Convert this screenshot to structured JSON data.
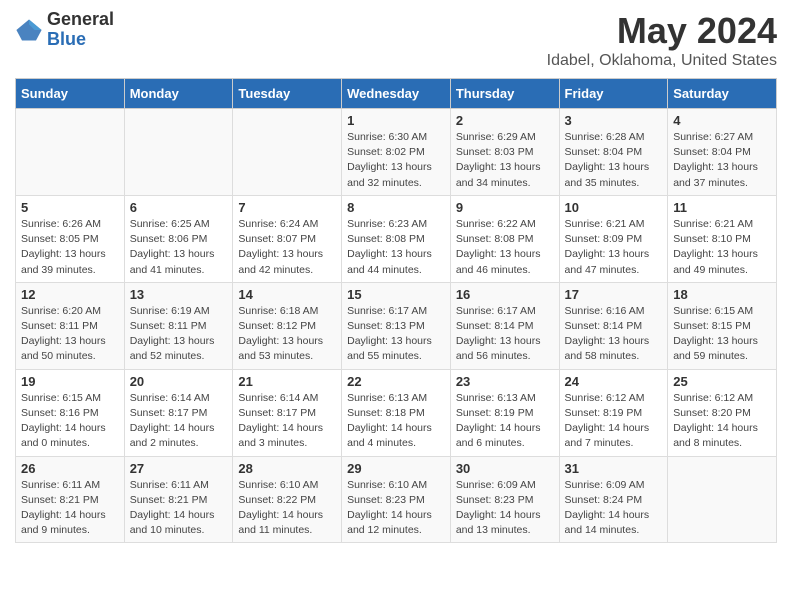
{
  "logo": {
    "general": "General",
    "blue": "Blue"
  },
  "title": "May 2024",
  "subtitle": "Idabel, Oklahoma, United States",
  "days_of_week": [
    "Sunday",
    "Monday",
    "Tuesday",
    "Wednesday",
    "Thursday",
    "Friday",
    "Saturday"
  ],
  "weeks": [
    [
      {
        "num": "",
        "info": ""
      },
      {
        "num": "",
        "info": ""
      },
      {
        "num": "",
        "info": ""
      },
      {
        "num": "1",
        "info": "Sunrise: 6:30 AM\nSunset: 8:02 PM\nDaylight: 13 hours\nand 32 minutes."
      },
      {
        "num": "2",
        "info": "Sunrise: 6:29 AM\nSunset: 8:03 PM\nDaylight: 13 hours\nand 34 minutes."
      },
      {
        "num": "3",
        "info": "Sunrise: 6:28 AM\nSunset: 8:04 PM\nDaylight: 13 hours\nand 35 minutes."
      },
      {
        "num": "4",
        "info": "Sunrise: 6:27 AM\nSunset: 8:04 PM\nDaylight: 13 hours\nand 37 minutes."
      }
    ],
    [
      {
        "num": "5",
        "info": "Sunrise: 6:26 AM\nSunset: 8:05 PM\nDaylight: 13 hours\nand 39 minutes."
      },
      {
        "num": "6",
        "info": "Sunrise: 6:25 AM\nSunset: 8:06 PM\nDaylight: 13 hours\nand 41 minutes."
      },
      {
        "num": "7",
        "info": "Sunrise: 6:24 AM\nSunset: 8:07 PM\nDaylight: 13 hours\nand 42 minutes."
      },
      {
        "num": "8",
        "info": "Sunrise: 6:23 AM\nSunset: 8:08 PM\nDaylight: 13 hours\nand 44 minutes."
      },
      {
        "num": "9",
        "info": "Sunrise: 6:22 AM\nSunset: 8:08 PM\nDaylight: 13 hours\nand 46 minutes."
      },
      {
        "num": "10",
        "info": "Sunrise: 6:21 AM\nSunset: 8:09 PM\nDaylight: 13 hours\nand 47 minutes."
      },
      {
        "num": "11",
        "info": "Sunrise: 6:21 AM\nSunset: 8:10 PM\nDaylight: 13 hours\nand 49 minutes."
      }
    ],
    [
      {
        "num": "12",
        "info": "Sunrise: 6:20 AM\nSunset: 8:11 PM\nDaylight: 13 hours\nand 50 minutes."
      },
      {
        "num": "13",
        "info": "Sunrise: 6:19 AM\nSunset: 8:11 PM\nDaylight: 13 hours\nand 52 minutes."
      },
      {
        "num": "14",
        "info": "Sunrise: 6:18 AM\nSunset: 8:12 PM\nDaylight: 13 hours\nand 53 minutes."
      },
      {
        "num": "15",
        "info": "Sunrise: 6:17 AM\nSunset: 8:13 PM\nDaylight: 13 hours\nand 55 minutes."
      },
      {
        "num": "16",
        "info": "Sunrise: 6:17 AM\nSunset: 8:14 PM\nDaylight: 13 hours\nand 56 minutes."
      },
      {
        "num": "17",
        "info": "Sunrise: 6:16 AM\nSunset: 8:14 PM\nDaylight: 13 hours\nand 58 minutes."
      },
      {
        "num": "18",
        "info": "Sunrise: 6:15 AM\nSunset: 8:15 PM\nDaylight: 13 hours\nand 59 minutes."
      }
    ],
    [
      {
        "num": "19",
        "info": "Sunrise: 6:15 AM\nSunset: 8:16 PM\nDaylight: 14 hours\nand 0 minutes."
      },
      {
        "num": "20",
        "info": "Sunrise: 6:14 AM\nSunset: 8:17 PM\nDaylight: 14 hours\nand 2 minutes."
      },
      {
        "num": "21",
        "info": "Sunrise: 6:14 AM\nSunset: 8:17 PM\nDaylight: 14 hours\nand 3 minutes."
      },
      {
        "num": "22",
        "info": "Sunrise: 6:13 AM\nSunset: 8:18 PM\nDaylight: 14 hours\nand 4 minutes."
      },
      {
        "num": "23",
        "info": "Sunrise: 6:13 AM\nSunset: 8:19 PM\nDaylight: 14 hours\nand 6 minutes."
      },
      {
        "num": "24",
        "info": "Sunrise: 6:12 AM\nSunset: 8:19 PM\nDaylight: 14 hours\nand 7 minutes."
      },
      {
        "num": "25",
        "info": "Sunrise: 6:12 AM\nSunset: 8:20 PM\nDaylight: 14 hours\nand 8 minutes."
      }
    ],
    [
      {
        "num": "26",
        "info": "Sunrise: 6:11 AM\nSunset: 8:21 PM\nDaylight: 14 hours\nand 9 minutes."
      },
      {
        "num": "27",
        "info": "Sunrise: 6:11 AM\nSunset: 8:21 PM\nDaylight: 14 hours\nand 10 minutes."
      },
      {
        "num": "28",
        "info": "Sunrise: 6:10 AM\nSunset: 8:22 PM\nDaylight: 14 hours\nand 11 minutes."
      },
      {
        "num": "29",
        "info": "Sunrise: 6:10 AM\nSunset: 8:23 PM\nDaylight: 14 hours\nand 12 minutes."
      },
      {
        "num": "30",
        "info": "Sunrise: 6:09 AM\nSunset: 8:23 PM\nDaylight: 14 hours\nand 13 minutes."
      },
      {
        "num": "31",
        "info": "Sunrise: 6:09 AM\nSunset: 8:24 PM\nDaylight: 14 hours\nand 14 minutes."
      },
      {
        "num": "",
        "info": ""
      }
    ]
  ]
}
